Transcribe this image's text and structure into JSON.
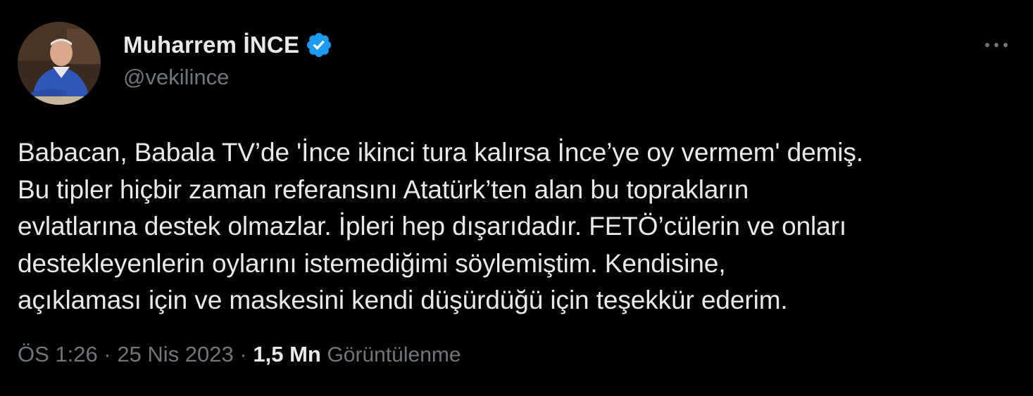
{
  "author": {
    "display_name": "Muharrem İNCE",
    "handle": "@vekilince",
    "verified": true,
    "avatar_icon": "profile-photo",
    "verified_icon": "verified-badge-icon",
    "verified_color": "#1d9bf0"
  },
  "more_icon": "more-options-icon",
  "tweet": {
    "text": "Babacan, Babala TV’de 'İnce ikinci tura kalırsa İnce’ye oy vermem' demiş.\nBu tipler hiçbir zaman referansını Atatürk’ten alan bu toprakların\nevlatlarına destek olmazlar. İpleri hep dışarıdadır. FETÖ’cülerin ve onları\ndestekleyenlerin oylarını istemediğimi söylemiştim. Kendisine,\naçıklaması için ve maskesini kendi düşürdüğü için teşekkür ederim."
  },
  "meta": {
    "time": "ÖS 1:26",
    "separator": "·",
    "date": "25 Nis 2023",
    "views_count": "1,5 Mn",
    "views_label": "Görüntülenme"
  },
  "colors": {
    "background": "#000000",
    "primary_text": "#e7e9ea",
    "secondary_text": "#71767b"
  }
}
